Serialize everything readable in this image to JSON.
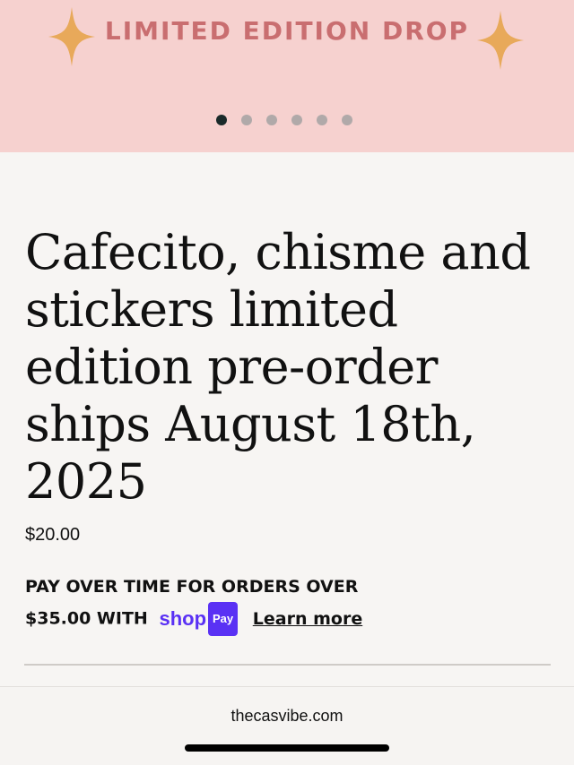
{
  "banner": {
    "title": "LIMITED EDITION DROP",
    "carousel": {
      "count": 6,
      "active_index": 0
    }
  },
  "product": {
    "title": "Cafecito, chisme and stickers limited edition pre-order ships August 18th, 2025",
    "price": "$20.00"
  },
  "installments": {
    "line1": "PAY OVER TIME FOR ORDERS OVER",
    "line2": "$35.00 WITH",
    "brand_word": "shop",
    "brand_badge": "Pay",
    "learn_more": "Learn more"
  },
  "browser": {
    "url": "thecasvibe.com"
  },
  "colors": {
    "banner_bg": "#f6d1cf",
    "banner_text": "#c96e70",
    "sparkle": "#e8a95a",
    "shop_pay": "#5a31f4"
  },
  "icons": [
    "sparkle-icon",
    "shop-pay-logo"
  ]
}
